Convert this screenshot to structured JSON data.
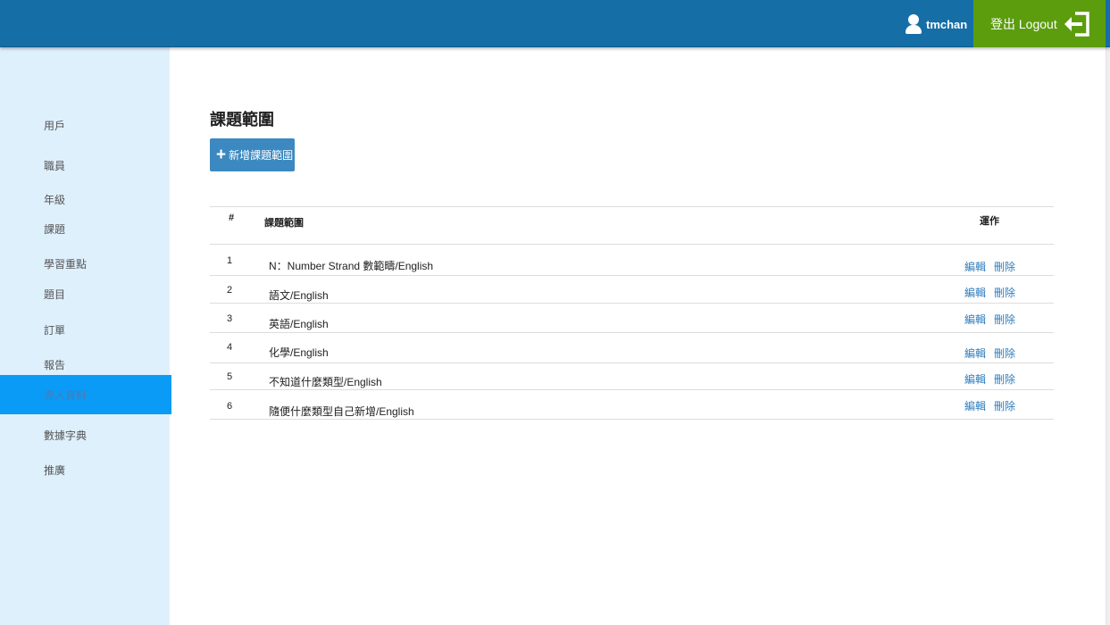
{
  "header": {
    "username": "tmchan",
    "logout_label": "登出 Logout"
  },
  "sidebar": {
    "items": [
      {
        "label": "用戶"
      },
      {
        "label": "職員"
      },
      {
        "label": "年級"
      },
      {
        "label": "課題"
      },
      {
        "label": "學習重點"
      },
      {
        "label": "題目"
      },
      {
        "label": "訂單"
      },
      {
        "label": "報告"
      },
      {
        "label": "導入資料"
      },
      {
        "label": "數據字典"
      },
      {
        "label": "推廣"
      }
    ],
    "active_index": 8
  },
  "main": {
    "title": "課題範圍",
    "add_button_label": "新增課題範圍",
    "table": {
      "columns": [
        "#",
        "課題範圍",
        "運作"
      ],
      "rows": [
        {
          "num": "1",
          "name": "N：Number Strand 數範疇/English",
          "edit": "編輯",
          "delete": "刪除"
        },
        {
          "num": "2",
          "name": "語文/English",
          "edit": "編輯",
          "delete": "刪除"
        },
        {
          "num": "3",
          "name": "英語/English",
          "edit": "編輯",
          "delete": "刪除"
        },
        {
          "num": "4",
          "name": "化學/English",
          "edit": "編輯",
          "delete": "刪除"
        },
        {
          "num": "5",
          "name": "不知道什麼類型/English",
          "edit": "編輯",
          "delete": "刪除"
        },
        {
          "num": "6",
          "name": "隨便什麼類型自己新增/English",
          "edit": "編輯",
          "delete": "刪除"
        }
      ]
    }
  },
  "colors": {
    "header_bg": "#166ea6",
    "logout_bg": "#5c9d0e",
    "sidebar_bg": "#dff0fd",
    "active_item_bg": "#0a9bf7",
    "add_button_bg": "#3b89c0",
    "action_link": "#2f7dbd"
  },
  "icons": {
    "user": "user-icon",
    "logout": "logout-icon",
    "add": "plus-icon"
  }
}
